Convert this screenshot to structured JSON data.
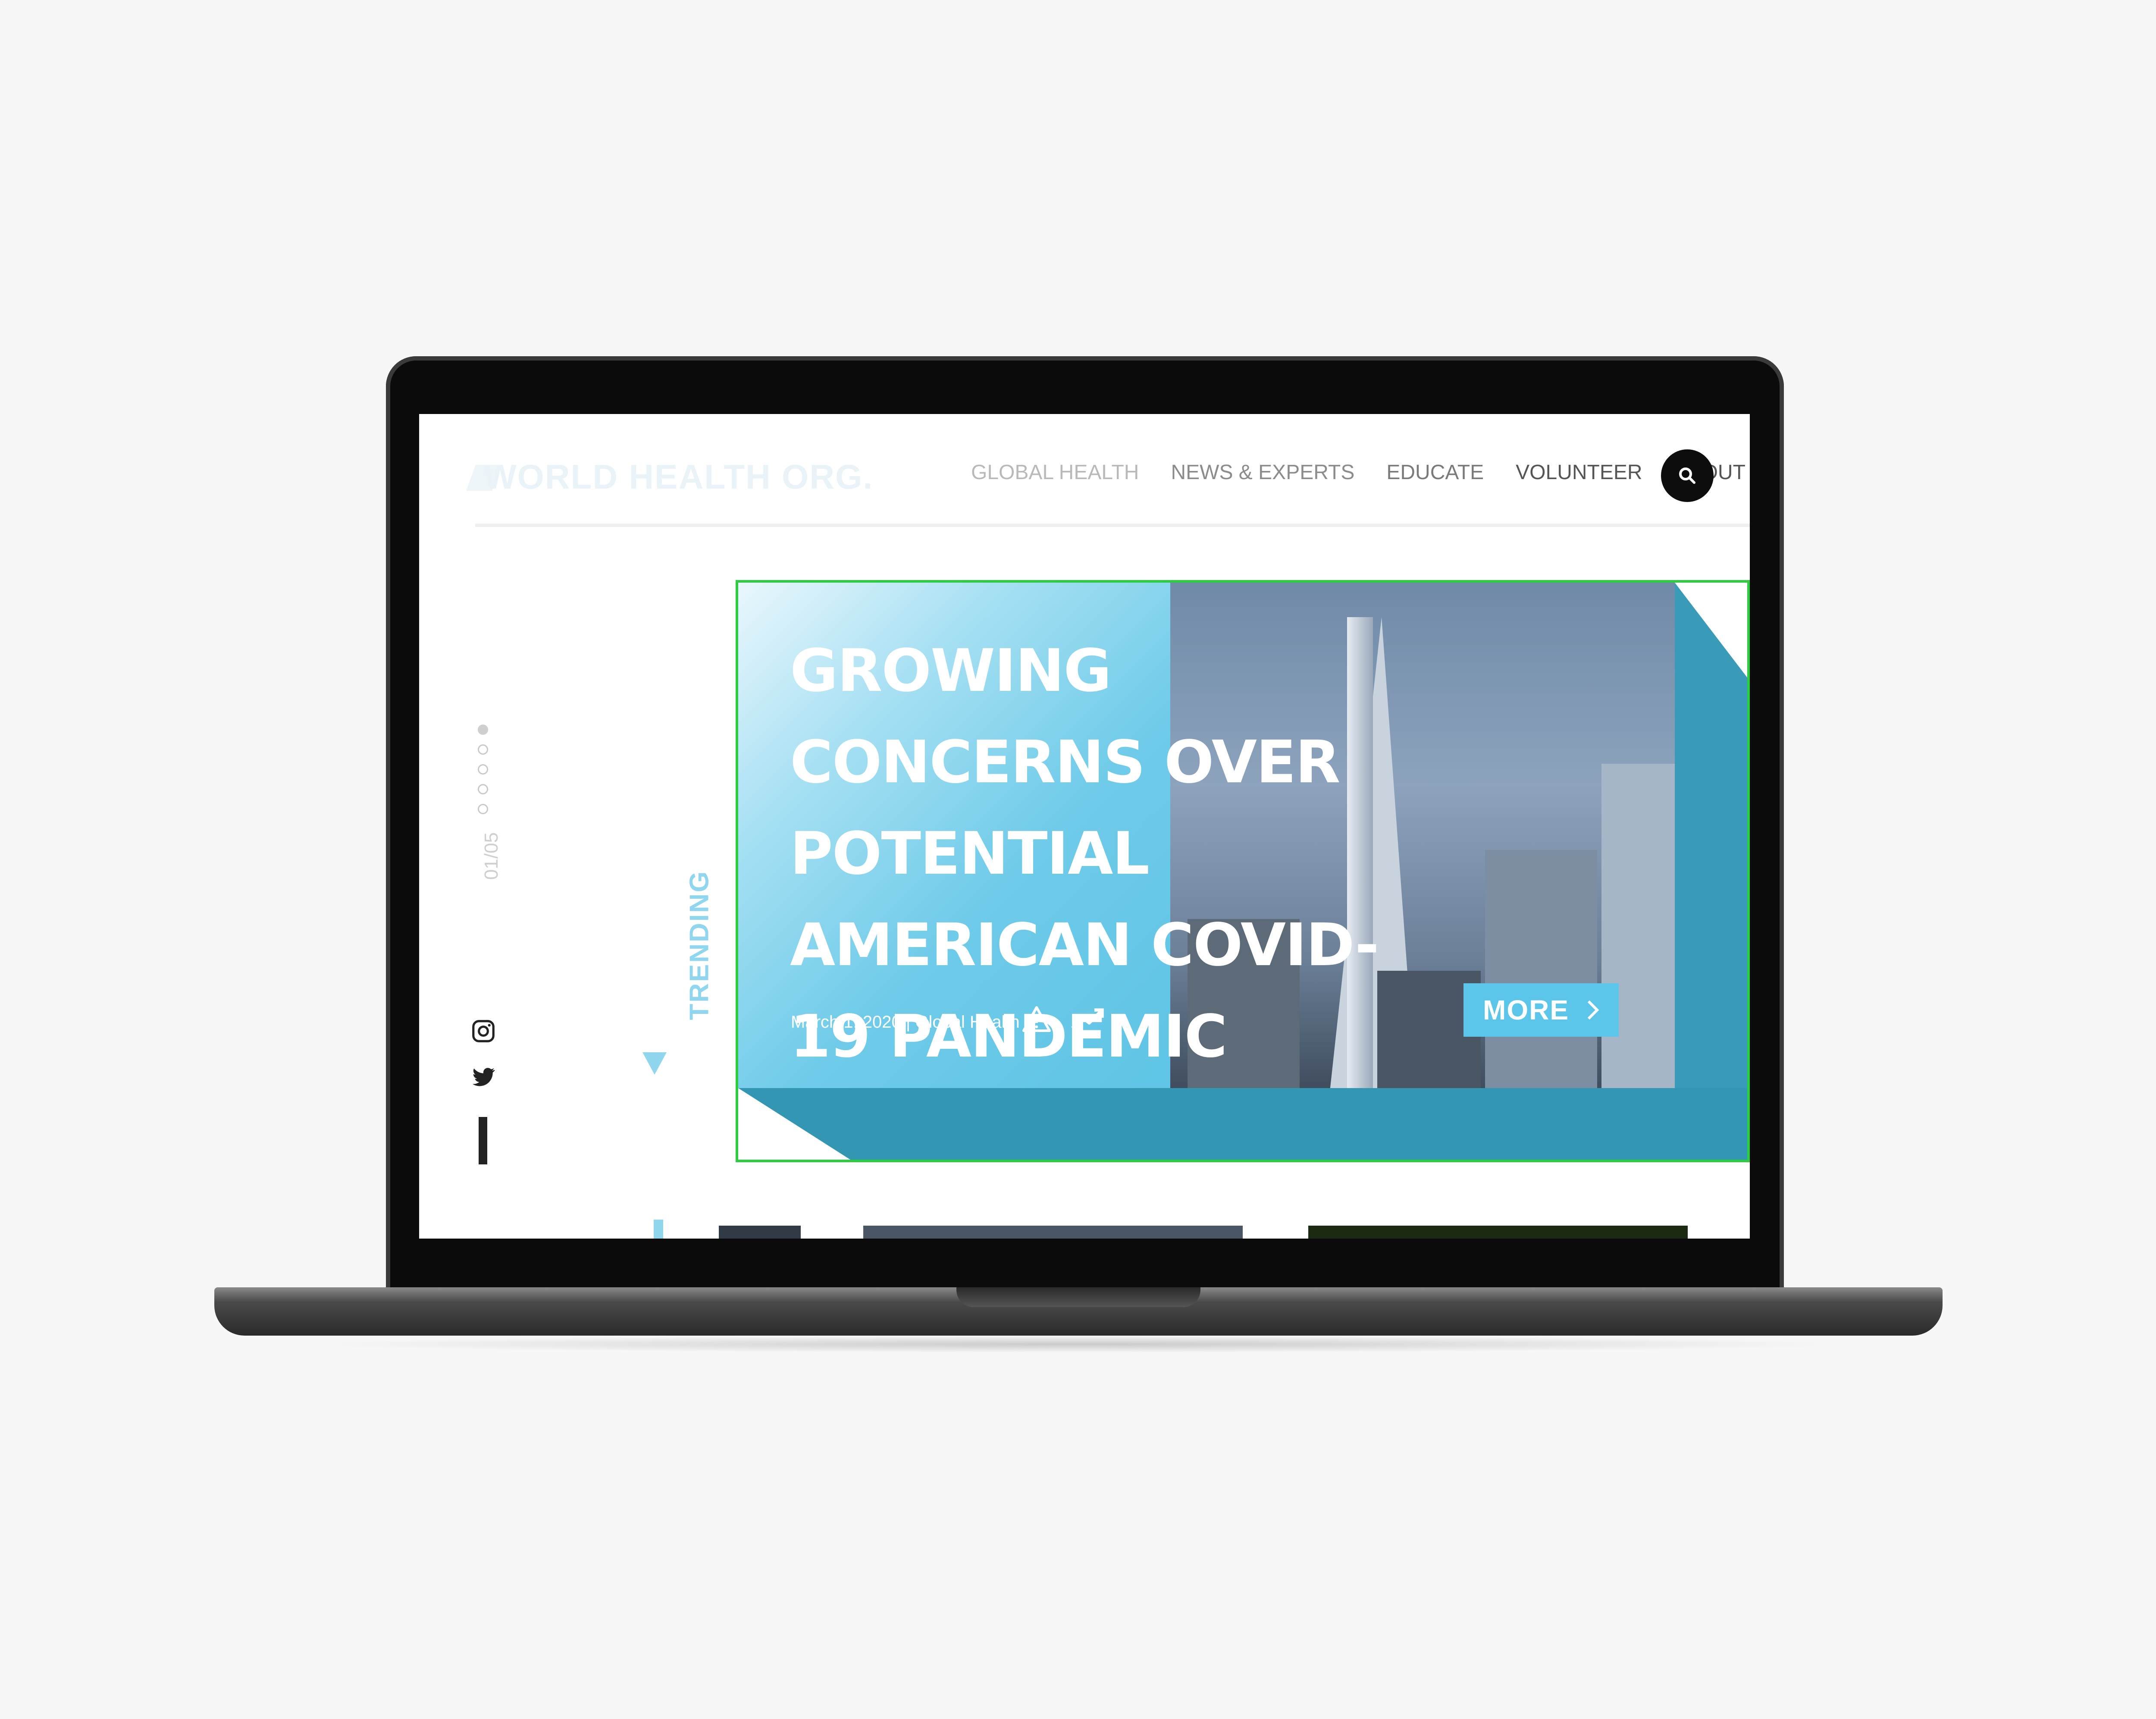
{
  "site": {
    "logo_text": "WORLD HEALTH ORG.",
    "nav": [
      {
        "label": "GLOBAL HEALTH",
        "color": "#b9b9b9"
      },
      {
        "label": "NEWS & EXPERTS",
        "color": "#8c8c8c"
      },
      {
        "label": "EDUCATE",
        "color": "#7a7a7a"
      },
      {
        "label": "VOLUNTEER",
        "color": "#555555"
      },
      {
        "label": "ABOUT US",
        "color": "#555555"
      }
    ],
    "search_icon": "search-icon"
  },
  "slider": {
    "counter": "01/05",
    "total_dots": 5,
    "active_index": 1
  },
  "social": {
    "icons": [
      "instagram-icon",
      "twitter-icon"
    ]
  },
  "trending_label": "TRENDING",
  "hero": {
    "title": "GROWING CONCERNS OVER POTENTIAL AMERICAN COVID-19 PANDEMIC",
    "meta": "March 1, 2020 | Global Health",
    "icons": [
      "warning-icon",
      "trending-up-icon"
    ],
    "more_label": "MORE",
    "colors": {
      "accent": "#5bc6ea",
      "teal": "#3396b3",
      "outline": "#2ecc40"
    }
  }
}
